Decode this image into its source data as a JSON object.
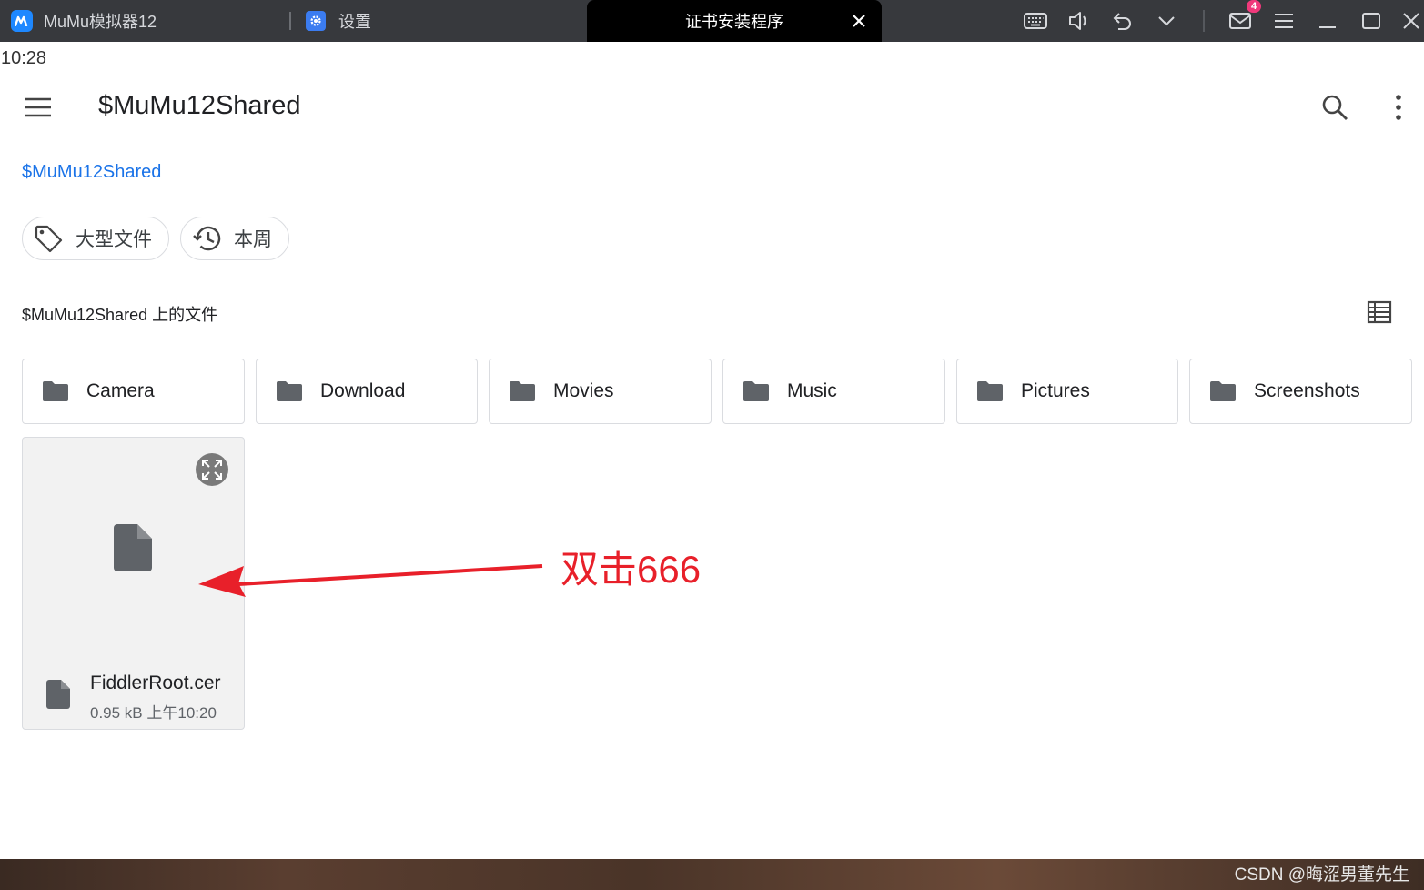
{
  "window": {
    "app_tab_title": "MuMu模拟器12",
    "settings_tab_title": "设置",
    "active_tab_title": "证书安装程序",
    "mail_badge": "4"
  },
  "status": {
    "time": "10:28"
  },
  "toolbar": {
    "title": "$MuMu12Shared"
  },
  "breadcrumb": {
    "current": "$MuMu12Shared"
  },
  "chips": [
    {
      "label": "大型文件",
      "icon": "tag-icon"
    },
    {
      "label": "本周",
      "icon": "history-icon"
    }
  ],
  "section": {
    "title": "$MuMu12Shared 上的文件"
  },
  "folders": [
    {
      "name": "Camera"
    },
    {
      "name": "Download"
    },
    {
      "name": "Movies"
    },
    {
      "name": "Music"
    },
    {
      "name": "Pictures"
    },
    {
      "name": "Screenshots"
    }
  ],
  "file": {
    "name": "FiddlerRoot.cer",
    "meta": "0.95 kB 上午10:20"
  },
  "annotation": {
    "text": "双击666",
    "color": "#e8202a"
  },
  "watermark": "CSDN @晦涩男董先生"
}
